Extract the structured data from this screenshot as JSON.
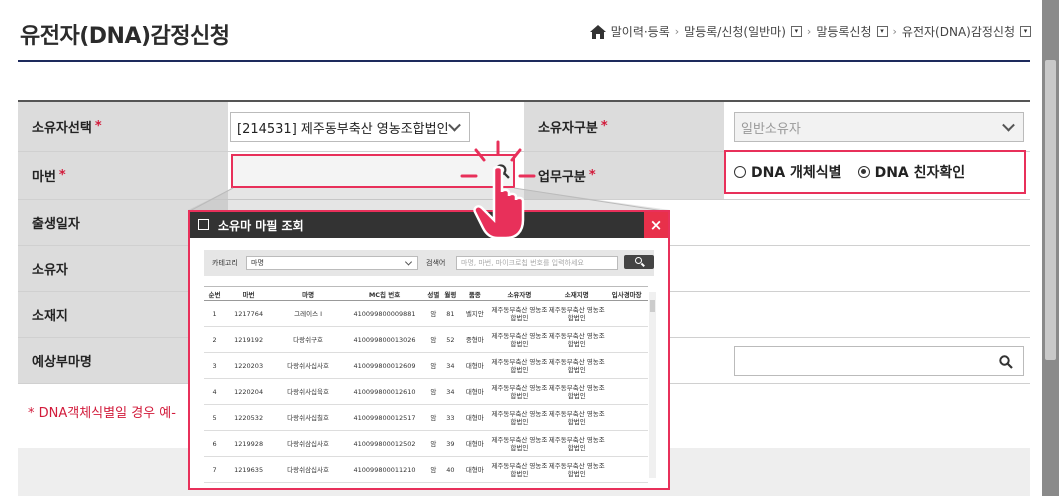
{
  "page": {
    "title": "유전자(DNA)감정신청"
  },
  "breadcrumb": {
    "items": [
      "말이력·등록",
      "말등록/신청(일반마)",
      "말등록신청",
      "유전자(DNA)감정신청"
    ]
  },
  "form": {
    "owner_select": {
      "label": "소유자선택",
      "value": "[214531] 제주동부축산 영농조합법인"
    },
    "owner_type": {
      "label": "소유자구분",
      "value": "일반소유자"
    },
    "horse_no": {
      "label": "마번",
      "value": ""
    },
    "work_type": {
      "label": "업무구분",
      "options": [
        "DNA 개체식별",
        "DNA 친자확인"
      ],
      "selected": "DNA 친자확인"
    },
    "birth_date": {
      "label": "출생일자"
    },
    "owner": {
      "label": "소유자"
    },
    "location": {
      "label": "소재지"
    },
    "expected_sire": {
      "label": "예상부마명"
    },
    "notice": "* DNA객체식별일 경우 예-"
  },
  "popup": {
    "title": "소유마 마필 조회",
    "close": "×",
    "search": {
      "category_label": "카테고리",
      "category_value": "마명",
      "keyword_label": "검색어",
      "keyword_placeholder": "마명, 마번, 마이크로칩 번호를 입력하세요"
    },
    "columns": [
      "순번",
      "마번",
      "마명",
      "MC칩 번호",
      "성별",
      "월령",
      "품종",
      "소유자명",
      "소재지명",
      "입사경마장"
    ],
    "rows": [
      [
        "1",
        "1217764",
        "그레이스 I",
        "410099800009881",
        "암",
        "81",
        "벨지안",
        "제주동부축산 영농조합법인",
        "제주동부축산 영농조합법인",
        ""
      ],
      [
        "2",
        "1219192",
        "다랑쉬구호",
        "410099800013026",
        "암",
        "52",
        "중형마",
        "제주동부축산 영농조합법인",
        "제주동부축산 영농조합법인",
        ""
      ],
      [
        "3",
        "1220203",
        "다랑쉬사십사호",
        "410099800012609",
        "암",
        "34",
        "대형마",
        "제주동부축산 영농조합법인",
        "제주동부축산 영농조합법인",
        ""
      ],
      [
        "4",
        "1220204",
        "다랑쉬사십육호",
        "410099800012610",
        "암",
        "34",
        "대형마",
        "제주동부축산 영농조합법인",
        "제주동부축산 영농조합법인",
        ""
      ],
      [
        "5",
        "1220532",
        "다랑쉬사십칠호",
        "410099800012517",
        "암",
        "33",
        "대형마",
        "제주동부축산 영농조합법인",
        "제주동부축산 영농조합법인",
        ""
      ],
      [
        "6",
        "1219928",
        "다랑쉬삼십사호",
        "410099800012502",
        "암",
        "39",
        "대형마",
        "제주동부축산 영농조합법인",
        "제주동부축산 영농조합법인",
        ""
      ],
      [
        "7",
        "1219635",
        "다랑쉬삼십사호",
        "410099800011210",
        "암",
        "40",
        "대형마",
        "제주동부축산 영농조합법인",
        "제주동부축산 영농조합법인",
        ""
      ]
    ]
  },
  "colors": {
    "accent": "#e8305a",
    "label_bg": "#dcdcdc",
    "title_rule": "#1d2a5c"
  }
}
